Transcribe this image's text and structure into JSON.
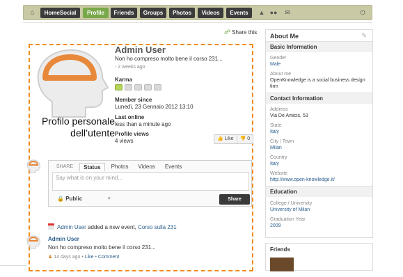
{
  "nav": {
    "tabs": [
      "HomeSocial",
      "Profile",
      "Friends",
      "Groups",
      "Photos",
      "Videos",
      "Events"
    ],
    "active_tab": "Profile"
  },
  "share_this": "Share this",
  "profile": {
    "name": "Admin User",
    "status": "Non ho compreso molto bene il corso 231...",
    "status_ago": "- 2 weeks ago",
    "karma_label": "Karma",
    "karma_level": 1,
    "karma_max": 5,
    "member_since_label": "Member since",
    "member_since": "Lunedì, 23 Gennaio 2012 13:10",
    "last_online_label": "Last online",
    "last_online": "less than a minute ago",
    "views_label": "Profile views",
    "views": "4 views",
    "like_label": "Like",
    "dislike_count": "0"
  },
  "overlay_label": "Profilo personale dell’utente",
  "share_box": {
    "tabs": [
      "SHARE",
      "Status",
      "Photos",
      "Videos",
      "Events"
    ],
    "active_tab": "Status",
    "placeholder": "Say what is on your mind...",
    "privacy": "Public",
    "share_button": "Share"
  },
  "activity": {
    "actor": "Admin User",
    "action": " added a new event, ",
    "target": "Corso sulla 231"
  },
  "post": {
    "author": "Admin User",
    "text": "Non ho compreso molto bene il corso 231...",
    "meta_time": "14 days ago",
    "meta_like": "Like",
    "meta_comment": "Comment"
  },
  "sidebar": {
    "title": "About Me",
    "basic_header": "Basic Information",
    "gender_label": "Gender",
    "gender": "Male",
    "about_label": "About me",
    "about": "OpenKnowledge is a social business design firm",
    "contact_header": "Contact Information",
    "address_label": "Address",
    "address": "Via De Amicis, 53",
    "state_label": "State",
    "state": "Italy",
    "city_label": "City / Town",
    "city": "Milan",
    "country_label": "Country",
    "country": "Italy",
    "website_label": "Website",
    "website": "http://www.open-knowledge.it/",
    "education_header": "Education",
    "college_label": "College / University",
    "college": "University of Milan",
    "grad_label": "Graduation Year",
    "grad_year": "2009",
    "friends_header": "Friends"
  },
  "colors": {
    "accent_green": "#78a84a",
    "highlight_orange": "#f28c1c",
    "nav_bg": "#c9c9a5",
    "link": "#2a5e8c"
  }
}
